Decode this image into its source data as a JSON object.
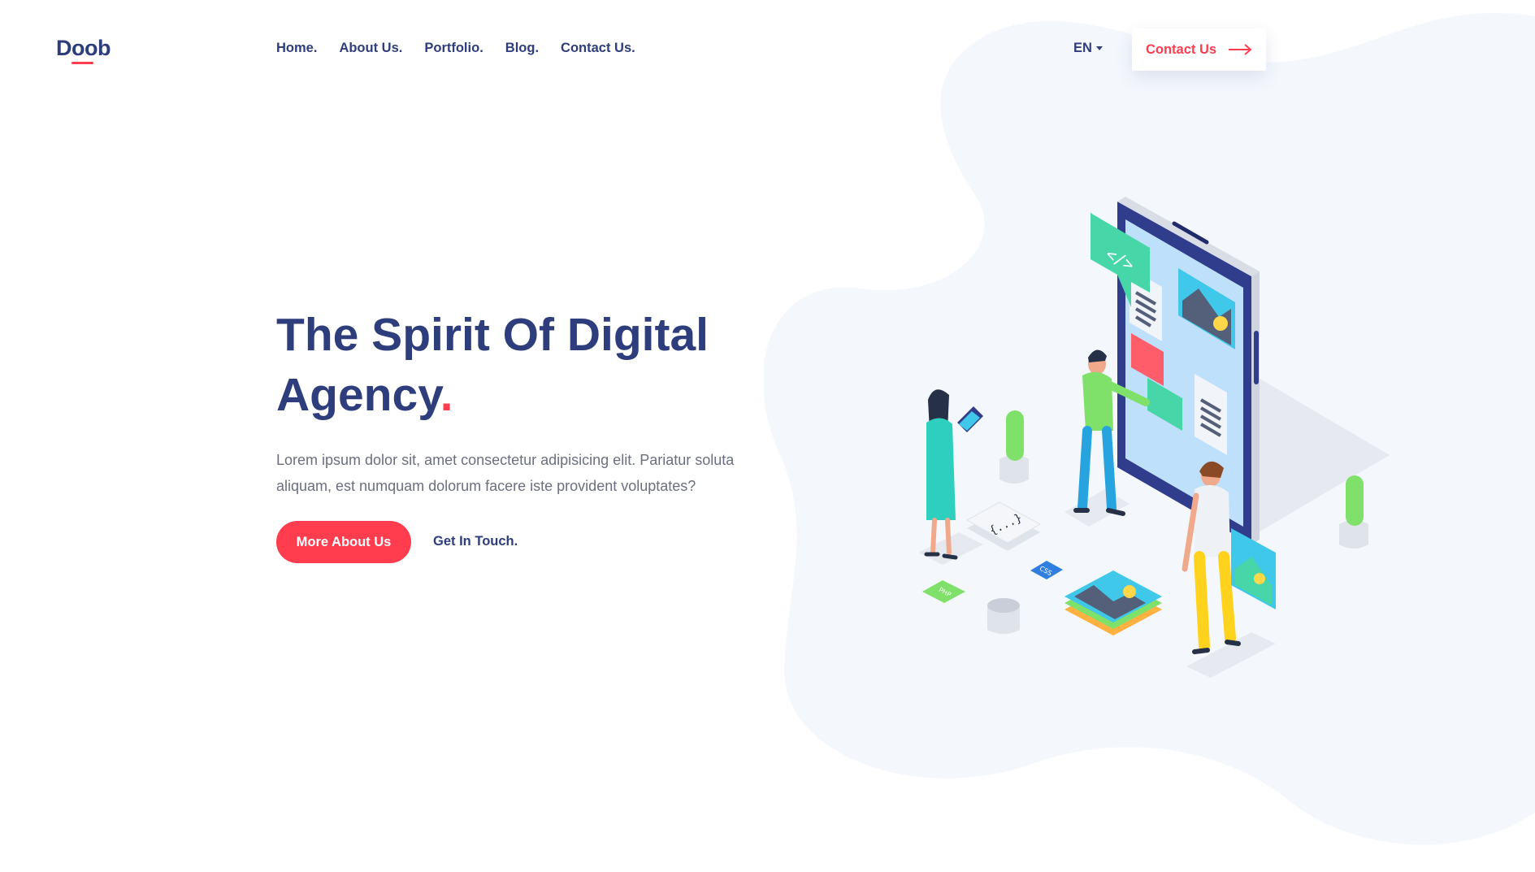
{
  "colors": {
    "primary": "#2e3d7c",
    "accent": "#ff3d4f",
    "blob": "#f4f8fd",
    "text_muted": "#6b6f80"
  },
  "header": {
    "logo": "Doob",
    "nav": [
      {
        "label": "Home"
      },
      {
        "label": "About Us"
      },
      {
        "label": "Portfolio"
      },
      {
        "label": "Blog"
      },
      {
        "label": "Contact Us"
      }
    ],
    "nav_suffix": ".",
    "language": "EN",
    "contact_button": "Contact Us",
    "contact_icon": "arrow-right-icon"
  },
  "hero": {
    "title": "The Spirit Of Digital Agency",
    "title_dot": ".",
    "description": "Lorem ipsum dolor sit, amet consectetur adipisicing elit. Pariatur soluta aliquam, est numquam dolorum facere iste provident voluptates?",
    "primary_button": "More About Us",
    "secondary_link": "Get In Touch."
  },
  "illustration": {
    "name": "isometric-mobile-app-illustration",
    "tags": [
      "</>",
      "{...}",
      "CSS",
      "PHP"
    ]
  }
}
